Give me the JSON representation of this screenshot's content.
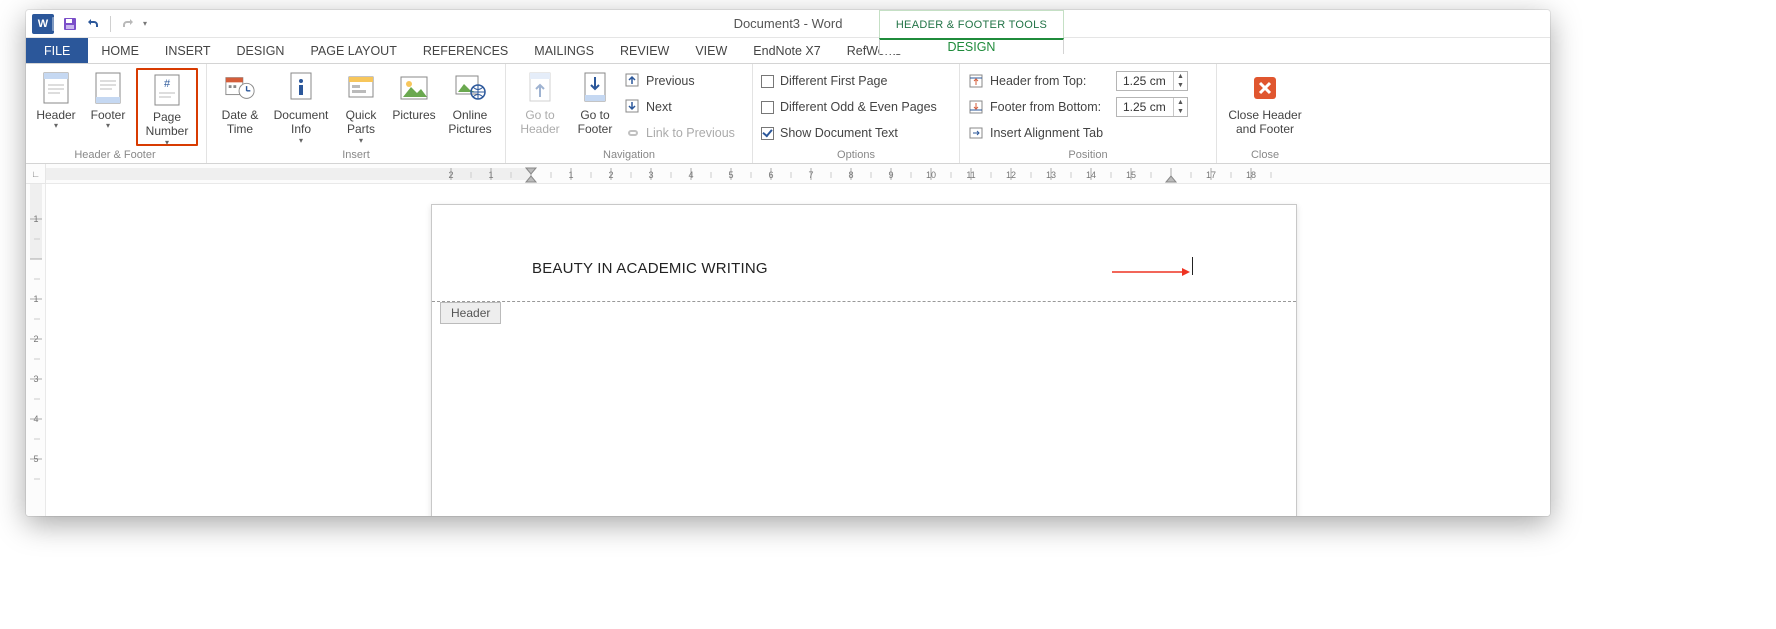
{
  "title": "Document3 - Word",
  "contextual_tab_title": "HEADER & FOOTER TOOLS",
  "tabs": {
    "file": "FILE",
    "home": "HOME",
    "insert": "INSERT",
    "design": "DESIGN",
    "page_layout": "PAGE LAYOUT",
    "references": "REFERENCES",
    "mailings": "MAILINGS",
    "review": "REVIEW",
    "view": "VIEW",
    "endnote": "EndNote X7",
    "refworks": "RefWorks",
    "design_ctx": "DESIGN"
  },
  "groups": {
    "header_footer": {
      "label": "Header & Footer",
      "header": "Header",
      "footer": "Footer",
      "page_number": "Page Number"
    },
    "insert": {
      "label": "Insert",
      "date_time": "Date & Time",
      "doc_info": "Document Info",
      "quick_parts": "Quick Parts",
      "pictures": "Pictures",
      "online_pictures": "Online Pictures"
    },
    "navigation": {
      "label": "Navigation",
      "go_header": "Go to Header",
      "go_footer": "Go to Footer",
      "previous": "Previous",
      "next": "Next",
      "link": "Link to Previous"
    },
    "options": {
      "label": "Options",
      "diff_first": "Different First Page",
      "diff_odd_even": "Different Odd & Even Pages",
      "show_doc": "Show Document Text"
    },
    "position": {
      "label": "Position",
      "header_top": "Header from Top:",
      "footer_bottom": "Footer from Bottom:",
      "header_val": "1.25 cm",
      "footer_val": "1.25 cm",
      "insert_align": "Insert Alignment Tab"
    },
    "close": {
      "label": "Close",
      "close_btn": "Close Header and Footer"
    }
  },
  "document": {
    "header_text": "BEAUTY IN ACADEMIC WRITING",
    "header_tag": "Header"
  },
  "ruler": {
    "h_labels": [
      "2",
      "1",
      "",
      "1",
      "2",
      "3",
      "4",
      "5",
      "6",
      "7",
      "8",
      "9",
      "10",
      "11",
      "12",
      "13",
      "14",
      "15",
      "",
      "17",
      "18"
    ],
    "v_labels": [
      "1",
      "",
      "1",
      "2",
      "3",
      "4",
      "5"
    ]
  }
}
